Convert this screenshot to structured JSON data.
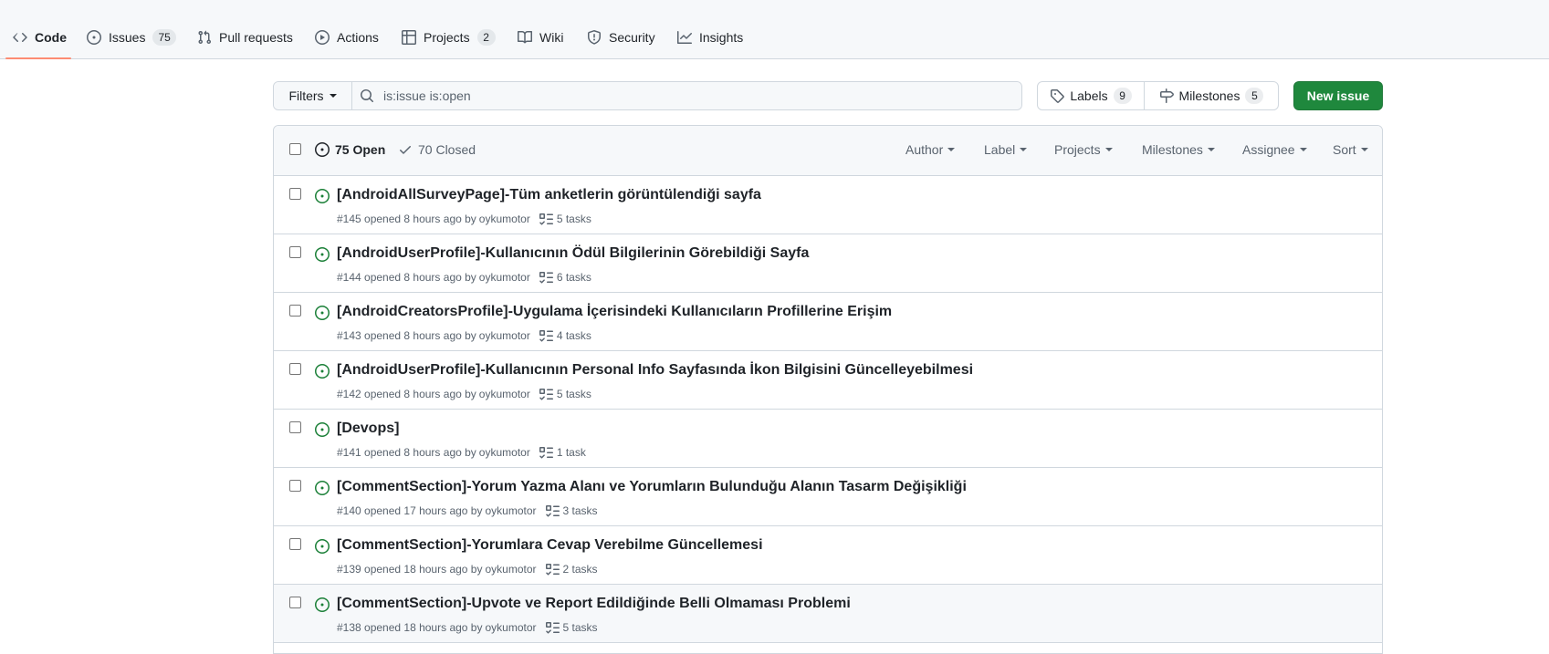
{
  "nav": {
    "items": [
      {
        "label": "Code",
        "icon": "code-icon",
        "selected": true
      },
      {
        "label": "Issues",
        "icon": "issue-opened-icon",
        "count": "75"
      },
      {
        "label": "Pull requests",
        "icon": "git-pull-request-icon"
      },
      {
        "label": "Actions",
        "icon": "play-icon"
      },
      {
        "label": "Projects",
        "icon": "table-icon",
        "count": "2"
      },
      {
        "label": "Wiki",
        "icon": "book-icon"
      },
      {
        "label": "Security",
        "icon": "shield-icon"
      },
      {
        "label": "Insights",
        "icon": "graph-icon"
      }
    ]
  },
  "filters": {
    "button_label": "Filters",
    "search_value": "is:issue is:open"
  },
  "labels_button": {
    "label": "Labels",
    "count": "9"
  },
  "milestones_button": {
    "label": "Milestones",
    "count": "5"
  },
  "new_issue_label": "New issue",
  "header": {
    "open_label": "75 Open",
    "closed_label": "70 Closed",
    "menus": [
      "Author",
      "Label",
      "Projects",
      "Milestones",
      "Assignee",
      "Sort"
    ]
  },
  "issues": [
    {
      "title": "[AndroidAllSurveyPage]-Tüm anketlerin görüntülendiği sayfa",
      "meta": "#145 opened 8 hours ago by",
      "author": "oykumotor",
      "tasks": "5 tasks"
    },
    {
      "title": "[AndroidUserProfile]-Kullanıcının Ödül Bilgilerinin Görebildiği Sayfa",
      "meta": "#144 opened 8 hours ago by",
      "author": "oykumotor",
      "tasks": "6 tasks"
    },
    {
      "title": "[AndroidCreatorsProfile]-Uygulama İçerisindeki Kullanıcıların Profillerine Erişim",
      "meta": "#143 opened 8 hours ago by",
      "author": "oykumotor",
      "tasks": "4 tasks"
    },
    {
      "title": "[AndroidUserProfile]-Kullanıcının Personal Info Sayfasında İkon Bilgisini Güncelleyebilmesi",
      "meta": "#142 opened 8 hours ago by",
      "author": "oykumotor",
      "tasks": "5 tasks"
    },
    {
      "title": "[Devops]",
      "meta": "#141 opened 8 hours ago by",
      "author": "oykumotor",
      "tasks": "1 task"
    },
    {
      "title": "[CommentSection]-Yorum Yazma Alanı ve Yorumların Bulunduğu Alanın Tasarm Değişikliği",
      "meta": "#140 opened 17 hours ago by",
      "author": "oykumotor",
      "tasks": "3 tasks"
    },
    {
      "title": "[CommentSection]-Yorumlara Cevap Verebilme Güncellemesi",
      "meta": "#139 opened 18 hours ago by",
      "author": "oykumotor",
      "tasks": "2 tasks"
    },
    {
      "title": "[CommentSection]-Upvote ve Report Edildiğinde Belli Olmaması Problemi",
      "meta": "#138 opened 18 hours ago by",
      "author": "oykumotor",
      "tasks": "5 tasks"
    }
  ]
}
